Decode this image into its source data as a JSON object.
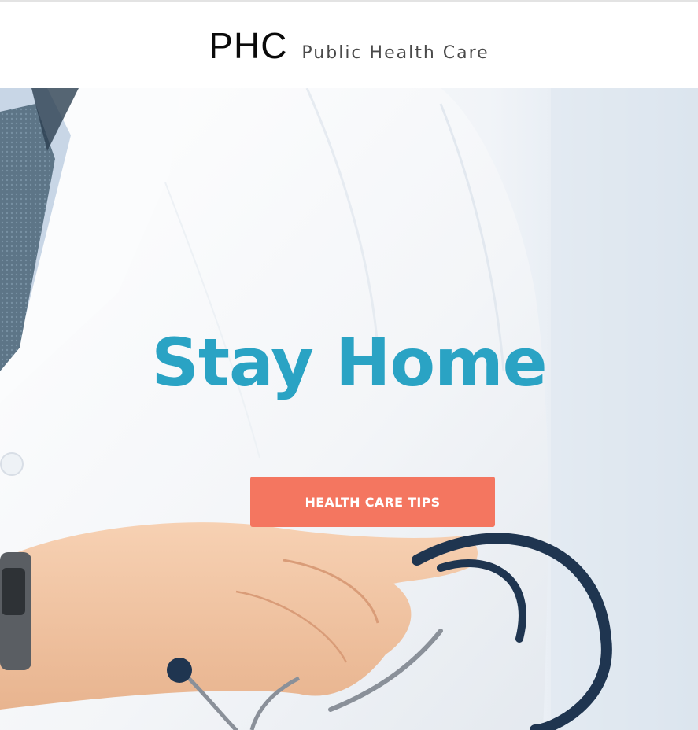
{
  "header": {
    "logo": "PHC",
    "tagline": "Public Health Care"
  },
  "hero": {
    "title": "Stay Home",
    "cta_label": "HEALTH CARE TIPS",
    "image_subject": "doctor-in-white-coat-with-stethoscope"
  },
  "colors": {
    "title": "#2aa3c4",
    "cta_background": "#f47660",
    "cta_text": "#ffffff",
    "logo": "#0a0a0a",
    "tagline": "#4a4a4a"
  }
}
